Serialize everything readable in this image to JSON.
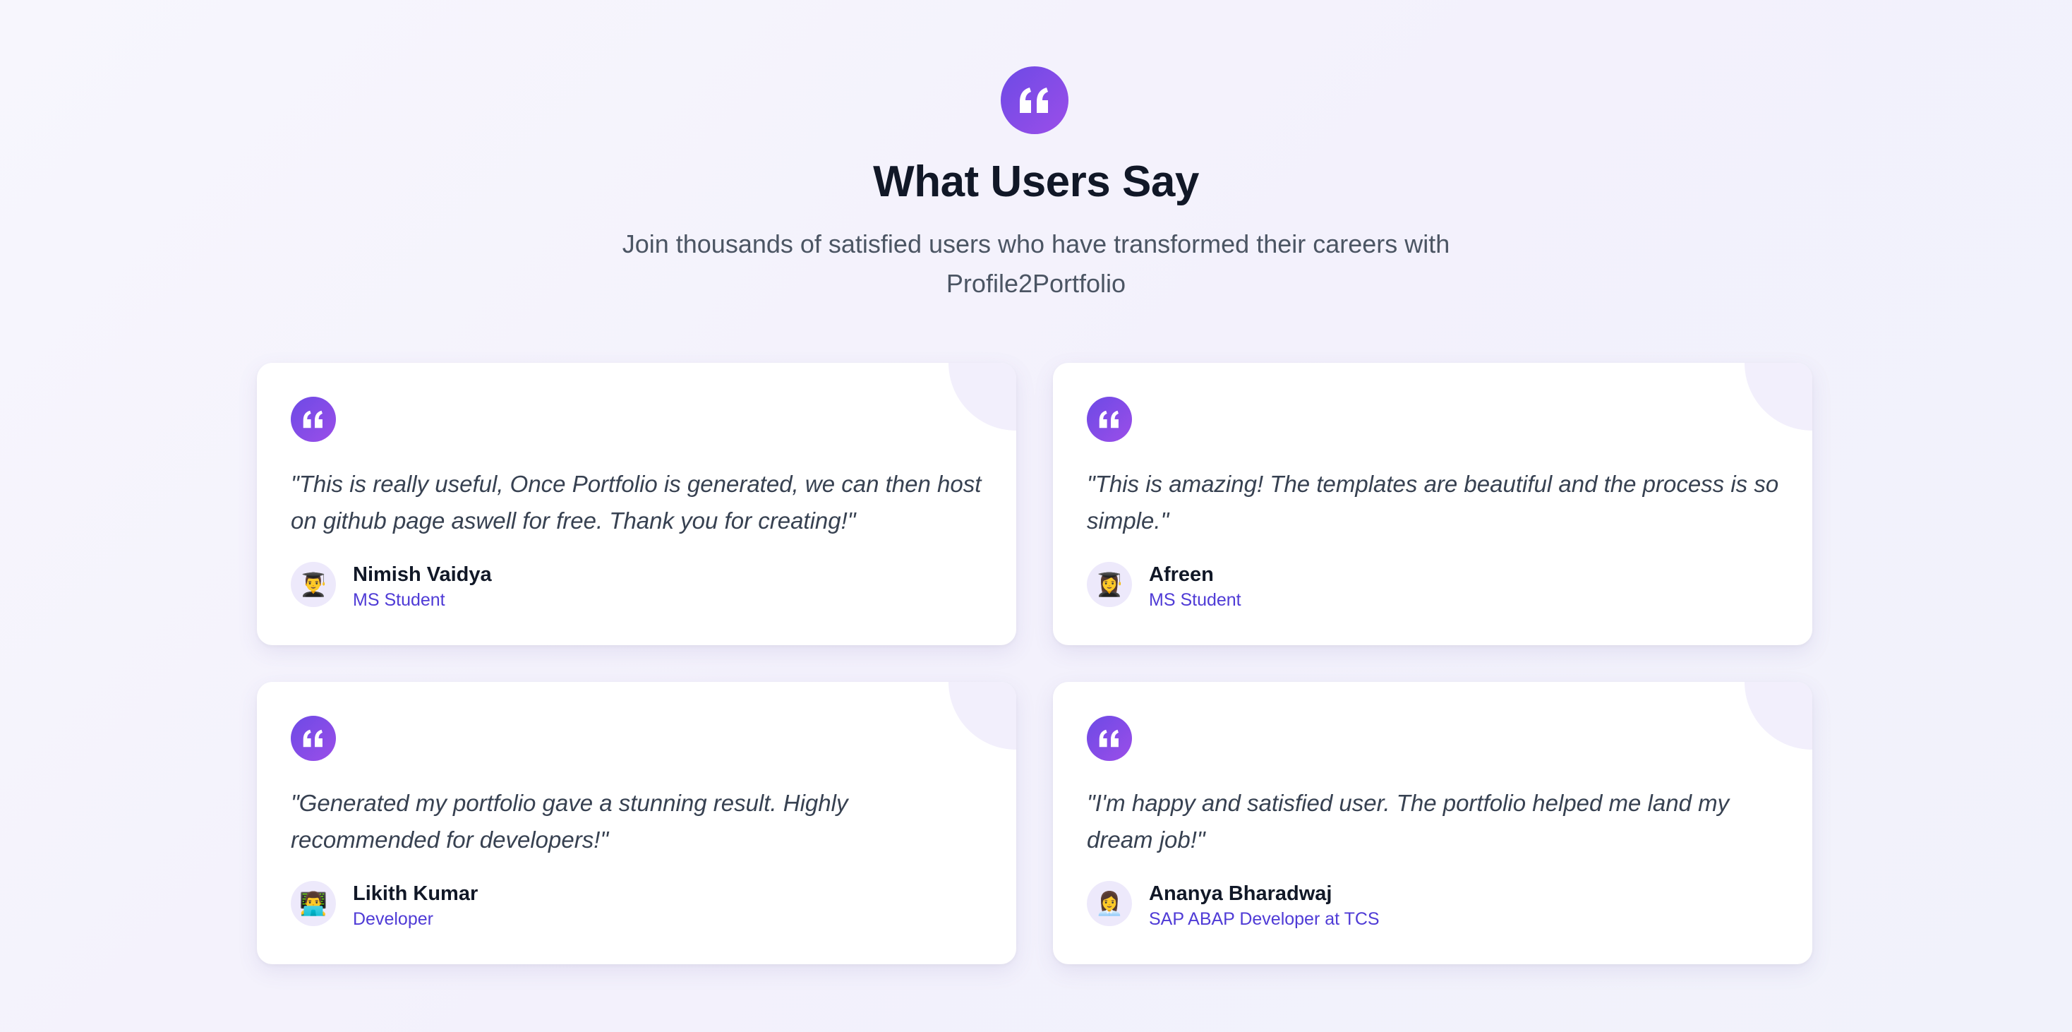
{
  "header": {
    "icon": "quote-icon",
    "title": "What Users Say",
    "subtitle": "Join thousands of satisfied users who have transformed their careers with Profile2Portfolio"
  },
  "colors": {
    "accent": "#7c4dea",
    "role_text": "#4f3bd6",
    "title_text": "#111827",
    "card_bg": "#ffffff"
  },
  "testimonials": [
    {
      "quote": "\"This is really useful, Once Portfolio is generated, we can then host on github page aswell for free. Thank you for creating!\"",
      "name": "Nimish Vaidya",
      "role": "MS Student",
      "avatar": "👨‍🎓",
      "avatar_icon": "student-man-icon"
    },
    {
      "quote": "\"This is amazing! The templates are beautiful and the process is so simple.\"",
      "name": "Afreen",
      "role": "MS Student",
      "avatar": "👩‍🎓",
      "avatar_icon": "student-woman-icon"
    },
    {
      "quote": "\"Generated my portfolio gave a stunning result. Highly recommended for developers!\"",
      "name": "Likith Kumar",
      "role": "Developer",
      "avatar": "👨‍💻",
      "avatar_icon": "technologist-icon"
    },
    {
      "quote": "\"I'm happy and satisfied user. The portfolio helped me land my dream job!\"",
      "name": "Ananya Bharadwaj",
      "role": "SAP ABAP Developer at TCS",
      "avatar": "👩‍💼",
      "avatar_icon": "office-worker-icon"
    }
  ]
}
